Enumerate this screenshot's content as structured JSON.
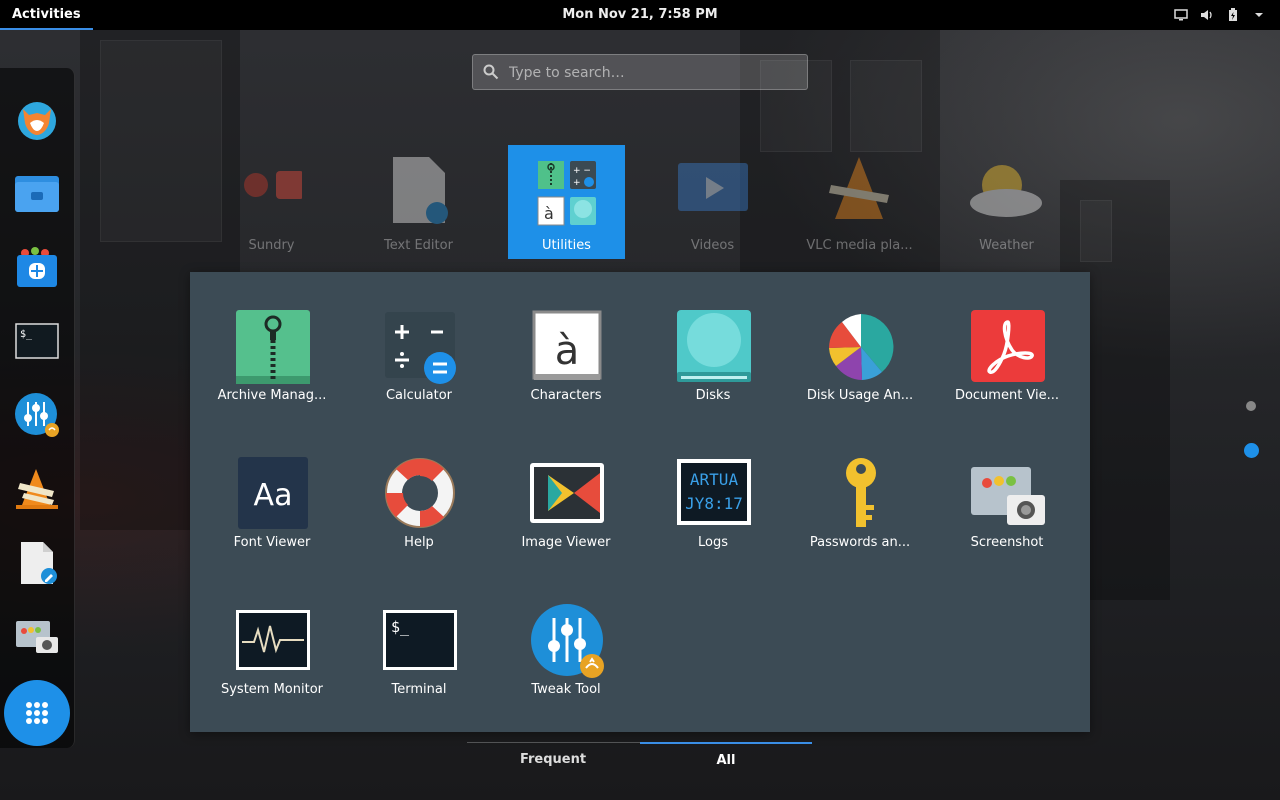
{
  "topbar": {
    "activities": "Activities",
    "clock": "Mon Nov 21,  7:58 PM"
  },
  "search": {
    "placeholder": "Type to search…"
  },
  "folders": [
    {
      "label": "Sundry"
    },
    {
      "label": "Text Editor"
    },
    {
      "label": "Utilities"
    },
    {
      "label": "Videos"
    },
    {
      "label": "VLC media pla..."
    },
    {
      "label": "Weather"
    }
  ],
  "utilities": {
    "apps": [
      {
        "label": "Archive Manag..."
      },
      {
        "label": "Calculator"
      },
      {
        "label": "Characters"
      },
      {
        "label": "Disks"
      },
      {
        "label": "Disk Usage An..."
      },
      {
        "label": "Document Vie..."
      },
      {
        "label": "Font Viewer"
      },
      {
        "label": "Help"
      },
      {
        "label": "Image Viewer"
      },
      {
        "label": "Logs"
      },
      {
        "label": "Passwords an..."
      },
      {
        "label": "Screenshot"
      },
      {
        "label": "System Monitor"
      },
      {
        "label": "Terminal"
      },
      {
        "label": "Tweak Tool"
      }
    ]
  },
  "icon_text": {
    "characters": "à",
    "font_viewer": "Aa",
    "logs_line1": "ARTUA",
    "logs_line2": "JY8:17",
    "terminal_prompt": "$_"
  },
  "switcher": {
    "frequent": "Frequent",
    "all": "All"
  },
  "colors": {
    "accent": "#1e90e8",
    "panel": "#3c4b55",
    "topbar": "#000000"
  }
}
